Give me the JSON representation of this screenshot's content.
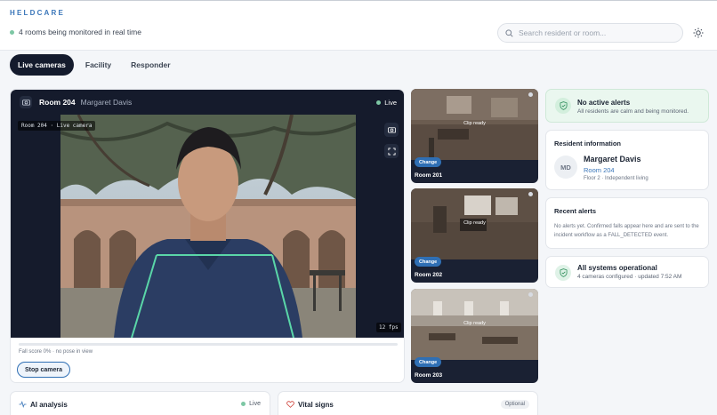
{
  "header": {
    "brand": "HELDCARE",
    "status": "4 rooms being monitored in real time",
    "search_placeholder": "Search resident or room...",
    "theme_icon": "sun-icon"
  },
  "tabs": [
    {
      "label": "Live cameras",
      "active": true
    },
    {
      "label": "Facility",
      "active": false
    },
    {
      "label": "Responder",
      "active": false
    }
  ],
  "main_camera": {
    "room": "Room 204",
    "resident": "Margaret Davis",
    "live_label": "Live",
    "overlay_label": "Room 204 · Live camera",
    "fps": "12 fps",
    "fall_score_text": "Fall score 0% · no pose in view",
    "fall_score": 0,
    "stop_label": "Stop camera"
  },
  "thumbnails": [
    {
      "room": "Room 201",
      "status": "Clip ready",
      "change_label": "Change"
    },
    {
      "room": "Room 202",
      "status": "Clip ready",
      "change_label": "Change"
    },
    {
      "room": "Room 203",
      "status": "Clip ready",
      "change_label": "Change"
    }
  ],
  "alerts_card": {
    "title": "No active alerts",
    "subtitle": "All residents are calm and being monitored."
  },
  "resident_info": {
    "title": "Resident information",
    "initials": "MD",
    "name": "Margaret Davis",
    "room": "Room 204",
    "details": "Floor 2 · Independent living"
  },
  "recent_alerts": {
    "title": "Recent alerts",
    "text": "No alerts yet. Confirmed falls appear here and are sent to the incident workflow as a FALL_DETECTED event."
  },
  "systems_card": {
    "title": "All systems operational",
    "subtitle": "4 cameras configured · updated 7:52 AM"
  },
  "ai_analysis": {
    "title": "AI analysis",
    "live_label": "Live"
  },
  "vital_signs": {
    "title": "Vital signs",
    "badge": "Optional"
  },
  "colors": {
    "accent": "#3a76b9",
    "dark": "#151b2c",
    "success": "#7dc7a4",
    "pose_line": "#5ad6a8"
  }
}
